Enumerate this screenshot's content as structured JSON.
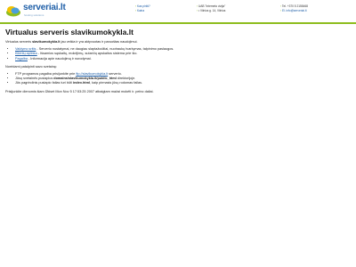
{
  "header": {
    "logo": {
      "name": "serveriai.lt",
      "tagline": "hosting solutions"
    },
    "col1": [
      "Kas pirkti?",
      "Kaina"
    ],
    "col2": [
      "UAB \"Interneto vizija\"",
      "• Vilnius g. 14, Vilnius"
    ],
    "col3": [
      "Tel. +370 5 2155468",
      "El. info@serveriai.lt"
    ]
  },
  "content": {
    "title": "Virtualus serveris slavikumokykla.lt",
    "intro": {
      "prefix": "Virtualus serveris ",
      "domain": "slavikumokykla.lt",
      "suffix": " jau veikia ir yra aktyvuotas ir paruoštas naudojimui."
    },
    "links_list": [
      {
        "link": "Valdymo sritis",
        "text": " - Serverio nustatymai, ne daugiau slaptažodžiai, nuotraukų tvarkymas, talpinimo paslaugos."
      },
      {
        "link": "Klientų aplinka",
        "text": " - Išsamios sąskaitų, mokėjimų, sutarčių apskaitos sistema prie šio."
      },
      {
        "link": "Pagalba",
        "text": " - Informacija apie naudojimą ir nurodymai."
      }
    ],
    "upload_heading": "Norėdami patalpinti savo svetainę:",
    "upload_list": [
      {
        "before": "FTP programos pagalba prisijunkite prie ",
        "link": "ftp://slavikumokykla.lt",
        "after": " serverio."
      },
      {
        "before": "Jūsų svetainės puslapius ",
        "bold": "domains/slavikumokykla.lt/public_html",
        "after": " direktorijoje."
      },
      {
        "before": "Jūs pagrindinis puslapio failas turi būti ",
        "bold": "index.html",
        "after": ", kaip pirmasis jūsų rodomas failas."
      }
    ],
    "footer": "Prisijunkite dienomis šiam Ūkiset Mon Nov 5 17:53:25 2007 atbaigtam mažai mokėti ir. pelno daliai."
  }
}
